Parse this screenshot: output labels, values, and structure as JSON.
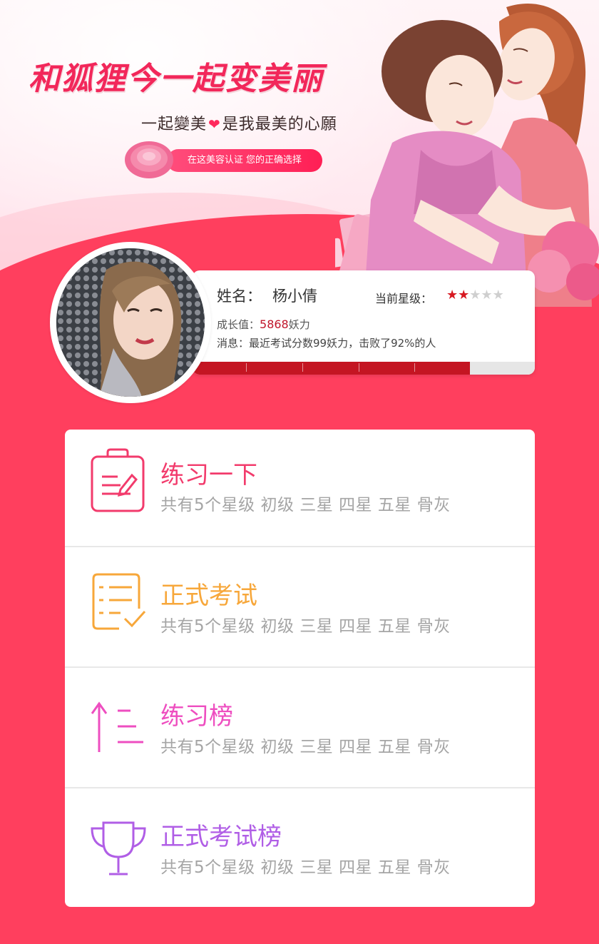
{
  "banner": {
    "headline": "和狐狸今一起变美丽",
    "subline_left": "一起變美",
    "subline_right": "是我最美的心願",
    "pill_text": "在这美容认证  您的正确选择"
  },
  "profile": {
    "name_label": "姓名：",
    "name": "杨小倩",
    "star_label": "当前星级：",
    "stars_filled": 2,
    "stars_total": 5,
    "growth_label": "成长值：",
    "growth_value": "5868",
    "growth_unit": "妖力",
    "message": "消息：最近考试分数99妖力，击败了92%的人",
    "progress": 0.81
  },
  "colors": {
    "accent": "#ff3f5e",
    "practice": "#f23b6c",
    "exam": "#f7a73a",
    "practice_rank": "#ee4ec0",
    "exam_rank": "#b05ee6"
  },
  "menu": [
    {
      "title": "练习一下",
      "subtitle": "共有5个星级 初级 三星 四星 五星 骨灰",
      "icon": "clipboard-pen-icon"
    },
    {
      "title": "正式考试",
      "subtitle": "共有5个星级 初级 三星 四星 五星 骨灰",
      "icon": "checklist-icon"
    },
    {
      "title": "练习榜",
      "subtitle": "共有5个星级 初级 三星 四星 五星 骨灰",
      "icon": "ranking-arrow-icon"
    },
    {
      "title": "正式考试榜",
      "subtitle": "共有5个星级 初级 三星 四星 五星 骨灰",
      "icon": "trophy-icon"
    }
  ]
}
